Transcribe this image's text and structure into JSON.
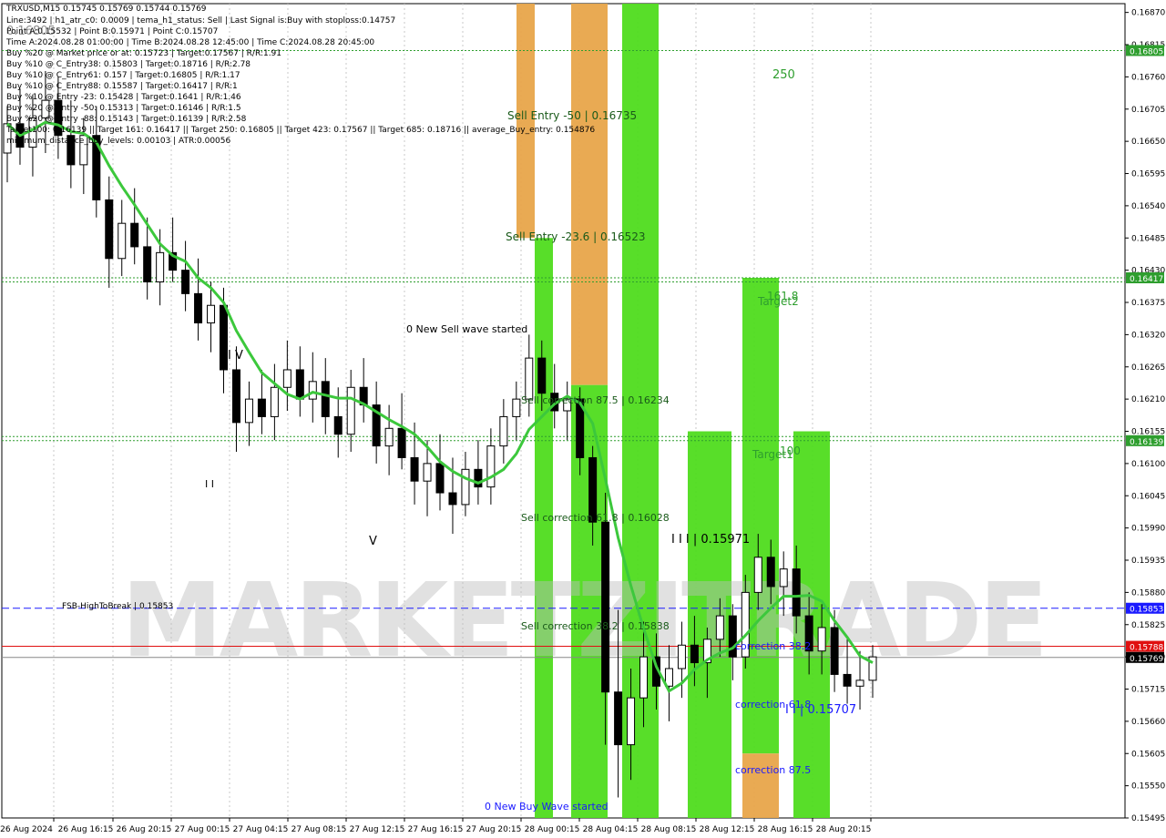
{
  "header": {
    "symbol_line": "TRXUSD,M15  0.15745 0.15769 0.15744 0.15769",
    "lines": [
      "Line:3492 | h1_atr_c0: 0.0009 | tema_h1_status: Sell | Last Signal is:Buy with stoploss:0.14757",
      "Point A:0.15532 | Point B:0.15971 | Point C:0.15707",
      "Time A:2024.08.28 01:00:00 | Time B:2024.08.28 12:45:00 | Time C:2024.08.28 20:45:00",
      "Buy %20 @ Market price or at: 0.15723 | Target:0.17567 | R/R:1.91",
      "Buy %10 @ C_Entry38: 0.15803 | Target:0.18716 | R/R:2.78",
      "Buy %10 @ C_Entry61: 0.157 | Target:0.16805 | R/R:1.17",
      "Buy %10 @ C_Entry88: 0.15587 | Target:0.16417 | R/R:1",
      "Buy %10 @ Entry -23: 0.15428 | Target:0.1641 | R/R:1.46",
      "Buy %20 @ Entry -50: 0.15313 | Target:0.16146 | R/R:1.5",
      "Buy %20 @ Entry -88: 0.15143 | Target:0.16139 | R/R:2.58",
      "Target100: 0.16139 || Target 161: 0.16417 || Target 250: 0.16805 || Target 423: 0.17567 || Target 685: 0.18716 || average_Buy_entry: 0.154876",
      "minimum_distance_buy_levels: 0.00103 | ATR:0.00056"
    ],
    "overlay_price": "0.16805"
  },
  "chart_data": {
    "type": "candlestick",
    "symbol": "TRXUSD",
    "timeframe": "M15",
    "ylim": [
      0.15495,
      0.16885
    ],
    "y_ticks": [
      "0.16870",
      "0.16815",
      "0.16760",
      "0.16705",
      "0.16650",
      "0.16595",
      "0.16540",
      "0.16485",
      "0.16430",
      "0.16375",
      "0.16320",
      "0.16265",
      "0.16210",
      "0.16155",
      "0.16100",
      "0.16045",
      "0.15990",
      "0.15935",
      "0.15880",
      "0.15825",
      "0.15770",
      "0.15715",
      "0.15660",
      "0.15605",
      "0.15550",
      "0.15495"
    ],
    "x_ticks": [
      "26 Aug 2024",
      "26 Aug 16:15",
      "26 Aug 20:15",
      "27 Aug 00:15",
      "27 Aug 04:15",
      "27 Aug 08:15",
      "27 Aug 12:15",
      "27 Aug 16:15",
      "27 Aug 20:15",
      "28 Aug 00:15",
      "28 Aug 04:15",
      "28 Aug 08:15",
      "28 Aug 12:15",
      "28 Aug 16:15",
      "28 Aug 20:15"
    ],
    "price_badges": [
      {
        "value": "0.16805",
        "color": "#2e9e2e"
      },
      {
        "value": "0.16417",
        "color": "#2e9e2e"
      },
      {
        "value": "0.16139",
        "color": "#2e9e2e"
      },
      {
        "value": "0.15853",
        "color": "#1a1aff"
      },
      {
        "value": "0.15788",
        "color": "#e01010"
      },
      {
        "value": "0.15769",
        "color": "#000000"
      }
    ],
    "horizontal_lines": [
      {
        "price": 0.16805,
        "color": "#2e9e2e",
        "style": "dotted"
      },
      {
        "price": 0.16417,
        "color": "#2e9e2e",
        "style": "dotted"
      },
      {
        "price": 0.1641,
        "color": "#2e9e2e",
        "style": "dotted"
      },
      {
        "price": 0.16146,
        "color": "#2e9e2e",
        "style": "dotted"
      },
      {
        "price": 0.16139,
        "color": "#2e9e2e",
        "style": "dotted"
      },
      {
        "price": 0.15853,
        "color": "#1a1aff",
        "style": "dashed"
      },
      {
        "price": 0.15788,
        "color": "#e01010",
        "style": "solid"
      },
      {
        "price": 0.15769,
        "color": "#888888",
        "style": "solid"
      }
    ],
    "zones": [
      {
        "price_top": 0.16885,
        "price_bottom": 0.16485,
        "color": "#e8a54a"
      },
      {
        "price_top": 0.16485,
        "price_bottom": 0.15495,
        "color": "#4fdc1d"
      },
      {
        "price_top": 0.16885,
        "price_bottom": 0.16234,
        "color": "#e8a54a"
      },
      {
        "price_top": 0.16234,
        "price_bottom": 0.15495,
        "color": "#4fdc1d"
      },
      {
        "price_top": 0.16885,
        "price_bottom": 0.15495,
        "color": "#4fdc1d"
      },
      {
        "price_top": 0.16155,
        "price_bottom": 0.15495,
        "color": "#4fdc1d"
      },
      {
        "price_top": 0.16417,
        "price_bottom": 0.15605,
        "color": "#4fdc1d"
      },
      {
        "price_top": 0.15605,
        "price_bottom": 0.15495,
        "color": "#e8a54a"
      },
      {
        "price_top": 0.16155,
        "price_bottom": 0.15495,
        "color": "#4fdc1d"
      }
    ],
    "labels": [
      {
        "text": "250",
        "color": "#2e9e2e"
      },
      {
        "text": "Sell Entry -50 | 0.16735",
        "color": "#1a5a1a"
      },
      {
        "text": "Sell Entry -23.6 | 0.16523",
        "color": "#1a5a1a"
      },
      {
        "text": "161.8",
        "color": "#2e9e2e"
      },
      {
        "text": "Target2",
        "color": "#2e9e2e"
      },
      {
        "text": "0 New Sell wave started",
        "color": "#000000"
      },
      {
        "text": "Sell correction 87.5 | 0.16234",
        "color": "#1a5a1a"
      },
      {
        "text": "100",
        "color": "#2e9e2e"
      },
      {
        "text": "Target1",
        "color": "#2e9e2e"
      },
      {
        "text": "Sell correction 61.8 | 0.16028",
        "color": "#1a5a1a"
      },
      {
        "text": "I I I | 0.15971",
        "color": "#000000"
      },
      {
        "text": "FSB-HighToBreak | 0.15853",
        "color": "#000000"
      },
      {
        "text": "Sell correction 38.2 | 0.15838",
        "color": "#1a5a1a"
      },
      {
        "text": "correction 38.2",
        "color": "#1a1aff"
      },
      {
        "text": "correction 61.8",
        "color": "#1a1aff"
      },
      {
        "text": "I I | 0.15707",
        "color": "#1a1aff"
      },
      {
        "text": "correction 87.5",
        "color": "#1a1aff"
      },
      {
        "text": "0 New Buy Wave started",
        "color": "#1a1aff"
      },
      {
        "text": "I V",
        "color": "#000000"
      },
      {
        "text": "I I",
        "color": "#000000"
      },
      {
        "text": "V",
        "color": "#000000"
      }
    ],
    "watermark": "MARKETZITRADE",
    "candles": [
      [
        0.1663,
        0.1671,
        0.1658,
        0.1668
      ],
      [
        0.1668,
        0.1674,
        0.1661,
        0.1664
      ],
      [
        0.1664,
        0.1673,
        0.1659,
        0.1669
      ],
      [
        0.1669,
        0.1677,
        0.1663,
        0.1672
      ],
      [
        0.1672,
        0.1676,
        0.1662,
        0.1666
      ],
      [
        0.1666,
        0.1672,
        0.1657,
        0.1661
      ],
      [
        0.1661,
        0.1669,
        0.1656,
        0.1666
      ],
      [
        0.1666,
        0.1671,
        0.1652,
        0.1655
      ],
      [
        0.1655,
        0.1659,
        0.164,
        0.1645
      ],
      [
        0.1645,
        0.1655,
        0.1642,
        0.1651
      ],
      [
        0.1651,
        0.1657,
        0.1644,
        0.1647
      ],
      [
        0.1647,
        0.1652,
        0.1638,
        0.1641
      ],
      [
        0.1641,
        0.165,
        0.1637,
        0.1646
      ],
      [
        0.1646,
        0.1652,
        0.1641,
        0.1643
      ],
      [
        0.1643,
        0.1648,
        0.1636,
        0.1639
      ],
      [
        0.1639,
        0.1645,
        0.1631,
        0.1634
      ],
      [
        0.1634,
        0.1641,
        0.1629,
        0.1637
      ],
      [
        0.1637,
        0.164,
        0.1622,
        0.1626
      ],
      [
        0.1626,
        0.163,
        0.1612,
        0.1617
      ],
      [
        0.1617,
        0.1624,
        0.1613,
        0.1621
      ],
      [
        0.1621,
        0.1626,
        0.1615,
        0.1618
      ],
      [
        0.1618,
        0.1627,
        0.1614,
        0.1623
      ],
      [
        0.1623,
        0.1631,
        0.1619,
        0.1626
      ],
      [
        0.1626,
        0.163,
        0.1618,
        0.1621
      ],
      [
        0.1621,
        0.1629,
        0.1617,
        0.1624
      ],
      [
        0.1624,
        0.1628,
        0.1615,
        0.1618
      ],
      [
        0.1618,
        0.1623,
        0.1611,
        0.1615
      ],
      [
        0.1615,
        0.1626,
        0.1612,
        0.1623
      ],
      [
        0.1623,
        0.1628,
        0.1617,
        0.162
      ],
      [
        0.162,
        0.1624,
        0.161,
        0.1613
      ],
      [
        0.1613,
        0.162,
        0.1608,
        0.1616
      ],
      [
        0.1616,
        0.1622,
        0.1609,
        0.1611
      ],
      [
        0.1611,
        0.1617,
        0.1603,
        0.1607
      ],
      [
        0.1607,
        0.1614,
        0.1601,
        0.161
      ],
      [
        0.161,
        0.1615,
        0.1602,
        0.1605
      ],
      [
        0.1605,
        0.1611,
        0.1598,
        0.1603
      ],
      [
        0.1603,
        0.1612,
        0.1601,
        0.1609
      ],
      [
        0.1609,
        0.1614,
        0.1603,
        0.1606
      ],
      [
        0.1606,
        0.1616,
        0.1603,
        0.1613
      ],
      [
        0.1613,
        0.1621,
        0.161,
        0.1618
      ],
      [
        0.1618,
        0.1624,
        0.1614,
        0.1621
      ],
      [
        0.1621,
        0.1632,
        0.1618,
        0.1628
      ],
      [
        0.1628,
        0.1631,
        0.1619,
        0.1622
      ],
      [
        0.1622,
        0.1627,
        0.1616,
        0.1619
      ],
      [
        0.1619,
        0.1624,
        0.1614,
        0.1621
      ],
      [
        0.1621,
        0.1623,
        0.1608,
        0.1611
      ],
      [
        0.1611,
        0.1613,
        0.1596,
        0.16
      ],
      [
        0.16,
        0.1605,
        0.1562,
        0.1571
      ],
      [
        0.1571,
        0.1585,
        0.1553,
        0.1562
      ],
      [
        0.1562,
        0.1575,
        0.1556,
        0.157
      ],
      [
        0.157,
        0.1583,
        0.1565,
        0.1577
      ],
      [
        0.1577,
        0.1581,
        0.1568,
        0.1572
      ],
      [
        0.1572,
        0.1579,
        0.1566,
        0.1575
      ],
      [
        0.1575,
        0.1583,
        0.157,
        0.1579
      ],
      [
        0.1579,
        0.1584,
        0.1572,
        0.1576
      ],
      [
        0.1576,
        0.1582,
        0.157,
        0.158
      ],
      [
        0.158,
        0.1587,
        0.1577,
        0.1584
      ],
      [
        0.1584,
        0.1586,
        0.1573,
        0.1577
      ],
      [
        0.1577,
        0.1591,
        0.1575,
        0.1588
      ],
      [
        0.1588,
        0.1598,
        0.1585,
        0.1594
      ],
      [
        0.1594,
        0.1597,
        0.1586,
        0.1589
      ],
      [
        0.1589,
        0.1595,
        0.1584,
        0.1592
      ],
      [
        0.1592,
        0.1596,
        0.1581,
        0.1584
      ],
      [
        0.1584,
        0.1588,
        0.1574,
        0.1578
      ],
      [
        0.1578,
        0.1586,
        0.1574,
        0.1582
      ],
      [
        0.1582,
        0.1585,
        0.1571,
        0.1574
      ],
      [
        0.1574,
        0.158,
        0.1569,
        0.1572
      ],
      [
        0.1572,
        0.1578,
        0.1568,
        0.1573
      ],
      [
        0.1573,
        0.1579,
        0.157,
        0.1577
      ]
    ]
  }
}
